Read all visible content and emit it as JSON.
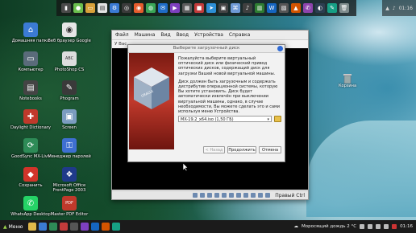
{
  "desktop": {
    "icons": [
      {
        "label": "Домашняя папка",
        "icon": "home-folder-icon",
        "color": "#3b7bd4",
        "glyph": "⌂"
      },
      {
        "label": "Компьютер",
        "icon": "computer-icon",
        "color": "#5a6b7a",
        "glyph": "▭"
      },
      {
        "label": "Notebooks",
        "icon": "notebook-icon",
        "color": "#444",
        "glyph": "▤"
      },
      {
        "label": "Daylight Dictionary",
        "icon": "dictionary-icon",
        "color": "#c0392b",
        "glyph": "✚"
      },
      {
        "label": "GoodSync MX-Live",
        "icon": "goodsync-icon",
        "color": "#2e8b57",
        "glyph": "⟳"
      },
      {
        "label": "Сохранить",
        "icon": "save-app-icon",
        "color": "#d1342a",
        "glyph": "◆"
      },
      {
        "label": "WhatsApp Desktop",
        "icon": "whatsapp-icon",
        "color": "#25d366",
        "glyph": "✆"
      }
    ],
    "icons_col2": [
      {
        "label": "Веб браузер Google",
        "icon": "browser-icon",
        "color": "#e6e6e6",
        "glyph": "◉"
      },
      {
        "label": "PhotoShop CS",
        "icon": "photoshop-icon",
        "color": "#ddd",
        "glyph": "ABC"
      },
      {
        "label": "Phogram",
        "icon": "phogram-icon",
        "color": "#3a3a3a",
        "glyph": "✎"
      },
      {
        "label": "Screen",
        "icon": "screen-icon",
        "color": "#7b9cc0",
        "glyph": "▣"
      },
      {
        "label": "Менеджер паролей",
        "icon": "password-manager-icon",
        "color": "#3e6fd1",
        "glyph": "⚿"
      },
      {
        "label": "Microsoft Office FrontPage 2003",
        "icon": "office-icon",
        "color": "#1f3a8a",
        "glyph": "❖"
      },
      {
        "label": "Master PDF Editor",
        "icon": "pdf-editor-icon",
        "color": "#c0392b",
        "glyph": "PDF"
      }
    ],
    "trash_label": "Корзина"
  },
  "vm_window": {
    "menu": [
      "Файл",
      "Машина",
      "Вид",
      "Ввод",
      "Устройства",
      "Справка"
    ],
    "toolbar_text": "У Вас",
    "host_key": "Правый Ctrl"
  },
  "dialog": {
    "title": "Выберите загрузочный диск",
    "paragraph1": "Пожалуйста выберите виртуальный оптический диск или физический привод оптических дисков, содержащий диск для загрузки Вашей новой виртуальной машины.",
    "paragraph2": "Диск должен быть загрузочным и содержать дистрибутив операционной системы, которую Вы хотите установить. Диск будет автоматически извлечён при выключении виртуальной машины, однако, в случае необходимости, Вы можете сделать это и сами используя меню Устройства.",
    "media_value": "MX-19.2_x64.iso (1,50 ГБ)",
    "back_label": "< Назад",
    "start_label": "Продолжить",
    "cancel_label": "Отмена",
    "art_text": "ORACLE VM VirtualBox"
  },
  "taskbar": {
    "menu_label": "Меню",
    "weather": "Моросящий дождь 2 °C",
    "time": "01:16"
  },
  "top_tray": {
    "time": "01:16"
  }
}
